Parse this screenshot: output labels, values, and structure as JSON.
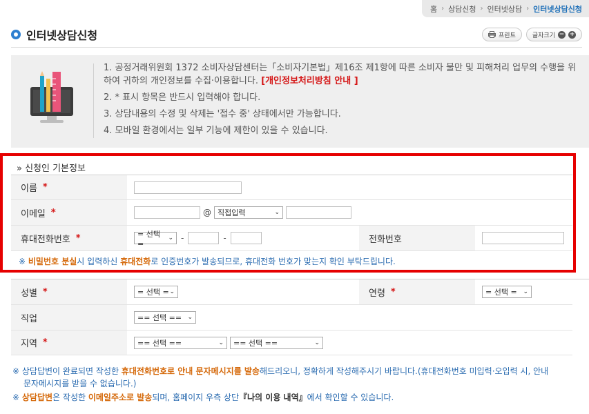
{
  "breadcrumb": {
    "home": "홈",
    "level1": "상담신청",
    "level2": "인터넷상담",
    "current": "인터넷상담신청"
  },
  "header": {
    "title": "인터넷상담신청",
    "print_label": "프린트",
    "font_size_label": "글자크기",
    "zoom_out": "−",
    "zoom_in": "+"
  },
  "notice": {
    "item1_text": "1. 공정거래위원회 1372 소비자상담센터는「소비자기본법」제16조 제1항에 따른 소비자 불만 및 피해처리 업무의 수행을 위하여 귀하의 개인정보를 수집·이용합니다.",
    "item1_link": "[개인정보처리방침 안내 ]",
    "item2": "2. * 표시 항목은 반드시 입력해야 합니다.",
    "item3": "3. 상담내용의 수정 및 삭제는 '접수 중' 상태에서만 가능합니다.",
    "item4": "4. 모바일 환경에서는 일부 기능에 제한이 있을 수 있습니다."
  },
  "basic_info": {
    "section_title": "» 신청인 기본정보",
    "name_label": "이름",
    "email_label": "이메일",
    "email_at": "@",
    "email_domain_selected": "직접입력",
    "mobile_label": "휴대전화번호",
    "mobile_prefix_selected": "= 선택 =",
    "dash": "-",
    "phone_label": "전화번호",
    "required_mark": "*"
  },
  "warning": {
    "prefix": "※ ",
    "part1": "비밀번호 분실",
    "part2": "시 입력하신 ",
    "part3": "휴대전화",
    "part4": "로 인증번호가 발송되므로, 휴대전화 번호가 맞는지 확인 부탁드립니다."
  },
  "extra_info": {
    "gender_label": "성별",
    "gender_selected": "= 선택 =",
    "age_label": "연령",
    "age_selected": "= 선택 =",
    "job_label": "직업",
    "job_selected": "== 선택 ==",
    "region_label": "지역",
    "region_selected_1": "== 선택 ==",
    "region_selected_2": "== 선택 =="
  },
  "footnotes": {
    "note1_a": "※ 상담답변이 완료되면 작성한 ",
    "note1_b": "휴대전화번호로 안내 문자메시지를 발송",
    "note1_c": "해드리오니, 정확하게 작성해주시기 바랍니다.(휴대전화번호 미입력·오입력 시, 안내",
    "note1_d": "문자메시지를 받을 수 없습니다.)",
    "note2_a": "※ ",
    "note2_b": "상담답변",
    "note2_c": "은 작성한 ",
    "note2_d": "이메일주소로 발송",
    "note2_e": "되며, 홈페이지 우측 상단",
    "note2_f": "『나의 이용 내역』",
    "note2_g": "에서 확인할 수 있습니다."
  },
  "colors": {
    "accent_blue": "#2d7fd0",
    "required_red": "#d51616",
    "highlight_red": "#e60000",
    "warn_orange": "#d5690a",
    "note_blue": "#2a6bb0"
  }
}
